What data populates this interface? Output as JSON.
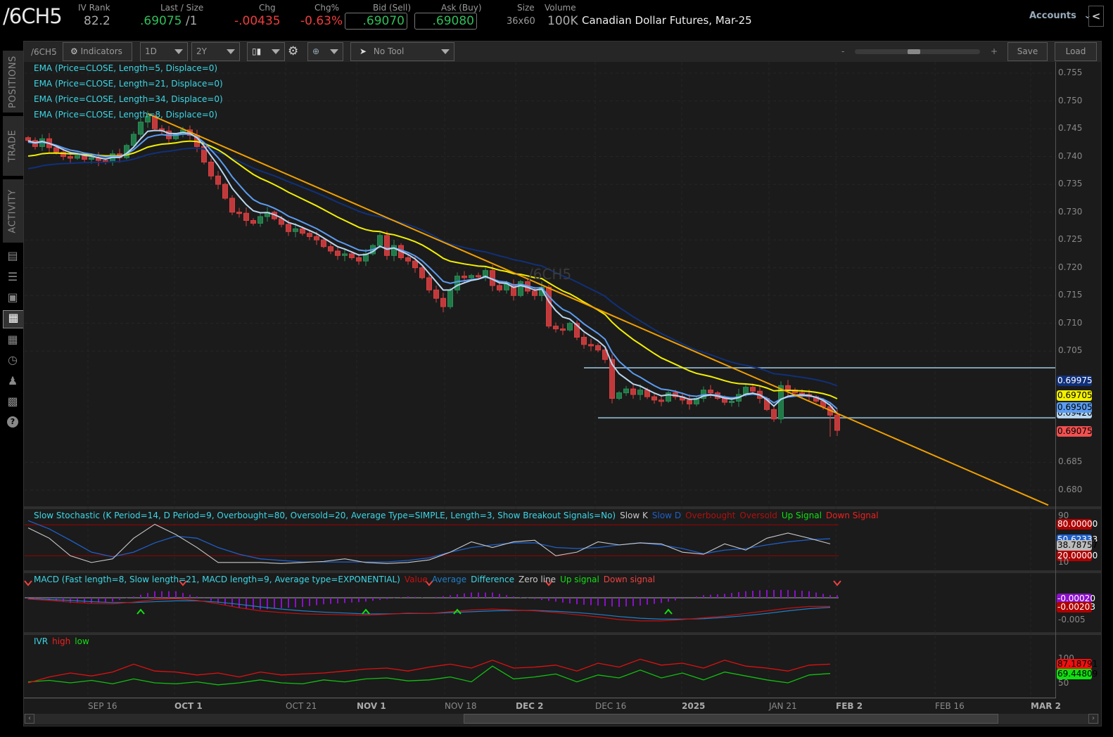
{
  "header": {
    "symbol": "/6CH5",
    "iv_rank_label": "IV Rank",
    "iv_rank": "82.2",
    "last_label": "Last / Size",
    "last": ".69075",
    "size": "/1",
    "chg_label": "Chg",
    "chg": "-.00435",
    "chgpct_label": "Chg%",
    "chgpct": "-0.63%",
    "bid_label": "Bid (Sell)",
    "bid": ".69070",
    "ask_label": "Ask (Buy)",
    "ask": ".69080",
    "sz_label": "Size",
    "sz": "36x60",
    "vol_label": "Volume",
    "vol": "100K",
    "description": "Canadian Dollar Futures, Mar-25",
    "accounts": "Accounts",
    "collapse": "<"
  },
  "sidebar": {
    "tabs": [
      "POSITIONS",
      "TRADE",
      "ACTIVITY"
    ],
    "icons": [
      "monitor-icon",
      "list-icon",
      "tv-icon",
      "charts-icon",
      "grid-icon",
      "clock-icon",
      "community-icon",
      "calendar-icon",
      "help-icon"
    ]
  },
  "toolbar": {
    "symbol": "/6CH5",
    "indicators": "Indicators",
    "aggregation": "1D",
    "range": "2Y",
    "no_tool": "No Tool",
    "zoom_minus": "-",
    "zoom_plus": "+",
    "zoom_level": 0.47,
    "save": "Save",
    "load": "Load"
  },
  "colors": {
    "up": "#2e8b57",
    "down": "#d84040",
    "ema5": "#b8d6ee",
    "ema8": "#5b9cf0",
    "ema21": "#f2f000",
    "ema34": "#10307a",
    "trend": "#f0a000",
    "hline": "#7f9fb2"
  },
  "chart_data": {
    "type": "candlestick",
    "watermark": "/6CH5",
    "legends": [
      "EMA (Price=CLOSE, Length=5, Displace=0)",
      "EMA (Price=CLOSE, Length=21, Displace=0)",
      "EMA (Price=CLOSE, Length=34, Displace=0)",
      "EMA (Price=CLOSE, Length=8, Displace=0)"
    ],
    "ylim": [
      0.6775,
      0.7575
    ],
    "yticks": [
      "0.755",
      "0.750",
      "0.745",
      "0.740",
      "0.735",
      "0.730",
      "0.725",
      "0.720",
      "0.715",
      "0.710",
      "0.705",
      "0.685",
      "0.680"
    ],
    "xticks": [
      {
        "label": "SEP 16",
        "bold": false
      },
      {
        "label": "OCT 1",
        "bold": true
      },
      {
        "label": "OCT 21",
        "bold": false
      },
      {
        "label": "NOV 1",
        "bold": true
      },
      {
        "label": "NOV 18",
        "bold": false
      },
      {
        "label": "DEC 2",
        "bold": true
      },
      {
        "label": "DEC 16",
        "bold": false
      },
      {
        "label": "2025",
        "bold": true
      },
      {
        "label": "JAN 21",
        "bold": false
      },
      {
        "label": "FEB 2",
        "bold": true
      },
      {
        "label": "FEB 16",
        "bold": false
      },
      {
        "label": "MAR 2",
        "bold": true
      }
    ],
    "closes": [
      0.7429,
      0.7418,
      0.7432,
      0.7416,
      0.7408,
      0.74,
      0.7397,
      0.7402,
      0.7395,
      0.7398,
      0.7393,
      0.739,
      0.7405,
      0.7398,
      0.742,
      0.744,
      0.7462,
      0.7472,
      0.745,
      0.7446,
      0.7432,
      0.744,
      0.7448,
      0.7438,
      0.7418,
      0.739,
      0.7365,
      0.735,
      0.7325,
      0.73,
      0.7298,
      0.7285,
      0.728,
      0.7292,
      0.73,
      0.7288,
      0.7278,
      0.7265,
      0.727,
      0.7262,
      0.7256,
      0.725,
      0.7238,
      0.723,
      0.7222,
      0.7225,
      0.7218,
      0.7212,
      0.7225,
      0.724,
      0.7258,
      0.7222,
      0.724,
      0.7218,
      0.7212,
      0.72,
      0.7182,
      0.716,
      0.7145,
      0.713,
      0.716,
      0.7185,
      0.7182,
      0.7186,
      0.7184,
      0.7195,
      0.7168,
      0.716,
      0.717,
      0.715,
      0.7175,
      0.7158,
      0.715,
      0.7165,
      0.7095,
      0.709,
      0.7088,
      0.71,
      0.7075,
      0.7062,
      0.706,
      0.7052,
      0.7035,
      0.6965,
      0.6975,
      0.6982,
      0.6972,
      0.698,
      0.6968,
      0.6962,
      0.696,
      0.6975,
      0.6968,
      0.6962,
      0.6955,
      0.6965,
      0.698,
      0.6975,
      0.6965,
      0.6958,
      0.696,
      0.6972,
      0.6985,
      0.6978,
      0.6965,
      0.6945,
      0.6928,
      0.6988,
      0.698,
      0.6975,
      0.6972,
      0.6968,
      0.696,
      0.695,
      0.6935,
      0.69075
    ],
    "trendline": {
      "from": [
        17,
        0.7477
      ],
      "to": [
        145,
        0.6773
      ]
    },
    "hlines": [
      {
        "price": 0.702,
        "from": 79
      },
      {
        "price": 0.693,
        "from": 81
      }
    ],
    "price_tags": [
      {
        "label": "0.69975",
        "bg": "#10307a",
        "fg": "#fff"
      },
      {
        "label": "0.69705",
        "bg": "#f2f000",
        "fg": "#000"
      },
      {
        "label": "0.69420",
        "bg": "#b8d6ee",
        "fg": "#000"
      },
      {
        "label": "0.69505",
        "bg": "#5b9cf0",
        "fg": "#000"
      },
      {
        "label": "0.69075",
        "bg": "#f05050",
        "fg": "#000"
      }
    ],
    "stochastic": {
      "legend": "Slow Stochastic (K Period=14, D Period=9, Overbought=80, Oversold=20, Average Type=SIMPLE, Length=3, Show Breakout Signals=No)",
      "keys": [
        {
          "label": "Slow K",
          "color": "#c8c8c8"
        },
        {
          "label": "Slow D",
          "color": "#1f5fc8"
        },
        {
          "label": "Overbought",
          "color": "#b01010"
        },
        {
          "label": "Oversold",
          "color": "#b01010"
        },
        {
          "label": "Up Signal",
          "color": "#10e010"
        },
        {
          "label": "Down Signal",
          "color": "#f02020"
        }
      ],
      "slow_k": [
        74,
        54,
        20,
        7,
        14,
        54,
        81,
        61,
        36,
        7,
        7,
        7,
        5,
        7,
        9,
        14,
        7,
        5,
        7,
        12,
        27,
        47,
        36,
        47,
        50,
        20,
        27,
        47,
        41,
        45,
        43,
        27,
        23,
        43,
        31,
        54,
        64,
        54,
        43
      ],
      "slow_d": [
        88,
        72,
        50,
        27,
        18,
        27,
        45,
        58,
        54,
        36,
        23,
        14,
        11,
        8,
        8,
        8,
        8,
        8,
        11,
        16,
        27,
        36,
        41,
        45,
        45,
        36,
        34,
        36,
        41,
        45,
        41,
        34,
        24,
        31,
        34,
        41,
        47,
        51,
        53
      ],
      "overbought": 80,
      "oversold": 20,
      "tags": [
        {
          "label": "80.00000",
          "bg": "#b00000",
          "fg": "#fff"
        },
        {
          "label": "50.62333",
          "bg": "#1f5fc8",
          "fg": "#fff"
        },
        {
          "label": "38.78757",
          "bg": "#bbbbbb",
          "fg": "#000"
        },
        {
          "label": "20.00000",
          "bg": "#b00000",
          "fg": "#fff"
        }
      ],
      "ticks": [
        "90",
        "10"
      ]
    },
    "macd": {
      "legend": "MACD (Fast length=8, Slow length=21, MACD length=9, Average type=EXPONENTIAL)",
      "keys": [
        {
          "label": "Value",
          "color": "#c81010"
        },
        {
          "label": "Average",
          "color": "#1f7fc8"
        },
        {
          "label": "Difference",
          "color": "#3cd7e6"
        },
        {
          "label": "Zero line",
          "color": "#c8c8c8"
        },
        {
          "label": "Up signal",
          "color": "#10e010"
        },
        {
          "label": "Down signal",
          "color": "#f04040"
        }
      ],
      "value_milli": [
        -0.3,
        -0.6,
        -1.0,
        -1.3,
        -1.4,
        -1.0,
        -0.4,
        -0.2,
        -0.6,
        -1.4,
        -2.3,
        -3.0,
        -3.4,
        -3.7,
        -3.8,
        -3.9,
        -4.0,
        -3.8,
        -3.5,
        -3.6,
        -3.2,
        -2.8,
        -2.6,
        -2.8,
        -3.0,
        -3.4,
        -3.9,
        -4.4,
        -5.0,
        -5.3,
        -5.3,
        -5.0,
        -4.6,
        -4.2,
        -3.6,
        -3.0,
        -2.4,
        -2.0,
        -2.0
      ],
      "avg_milli": [
        -0.2,
        -0.4,
        -0.6,
        -0.9,
        -1.1,
        -1.1,
        -0.9,
        -0.7,
        -0.7,
        -1.0,
        -1.5,
        -2.1,
        -2.6,
        -3.0,
        -3.3,
        -3.5,
        -3.7,
        -3.7,
        -3.6,
        -3.6,
        -3.4,
        -3.2,
        -3.0,
        -2.9,
        -2.9,
        -3.1,
        -3.4,
        -3.8,
        -4.3,
        -4.7,
        -4.9,
        -4.9,
        -4.8,
        -4.5,
        -4.1,
        -3.6,
        -3.0,
        -2.5,
        -2.2
      ],
      "down_signals": [
        0,
        22,
        57,
        74,
        115
      ],
      "up_signals": [
        16,
        48,
        61,
        91
      ],
      "tags": [
        {
          "label": "-0.00020",
          "bg": "#8a10c8",
          "fg": "#fff"
        },
        {
          "label": "-0.00203",
          "bg": "#b00000",
          "fg": "#fff"
        }
      ],
      "ticks": [
        "-0.005"
      ]
    },
    "ivr": {
      "legend": "IVR",
      "keys": [
        {
          "label": "high",
          "color": "#f02020"
        },
        {
          "label": "low",
          "color": "#10e010"
        }
      ],
      "high": [
        50,
        62,
        70,
        64,
        72,
        88,
        74,
        72,
        66,
        70,
        62,
        72,
        66,
        68,
        70,
        74,
        78,
        80,
        74,
        82,
        88,
        80,
        96,
        80,
        82,
        86,
        74,
        90,
        82,
        98,
        86,
        90,
        80,
        96,
        84,
        80,
        74,
        86,
        88
      ],
      "low": [
        52,
        55,
        50,
        55,
        48,
        58,
        50,
        48,
        52,
        46,
        50,
        56,
        50,
        48,
        56,
        52,
        58,
        60,
        54,
        56,
        62,
        52,
        84,
        58,
        62,
        68,
        52,
        66,
        60,
        76,
        60,
        70,
        56,
        72,
        64,
        56,
        50,
        66,
        69
      ],
      "tags": [
        {
          "label": "87.18791",
          "bg": "#f01010",
          "fg": "#000"
        },
        {
          "label": "69.44809",
          "bg": "#10e010",
          "fg": "#000"
        }
      ],
      "ticks": [
        "100",
        "50"
      ]
    }
  },
  "scrollbar": {
    "left": "‹",
    "right": "›"
  }
}
